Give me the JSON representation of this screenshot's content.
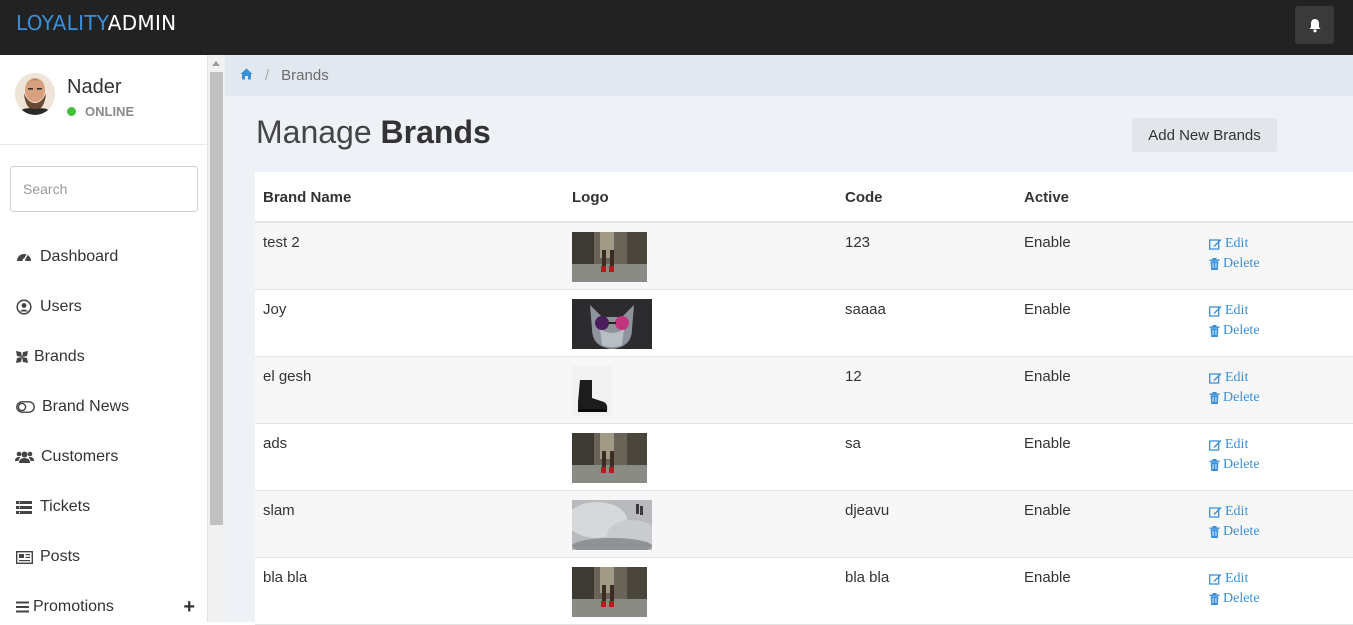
{
  "header": {
    "logo_part1": "LOYALITY",
    "logo_part2": "ADMIN",
    "accent_color": "#3a8fd9",
    "notification_icon": "bell-icon"
  },
  "sidebar": {
    "user": {
      "name": "Nader",
      "status": "ONLINE",
      "status_color": "#43c13b"
    },
    "search_placeholder": "Search",
    "items": [
      {
        "label": "Dashboard",
        "icon": "dashboard-icon"
      },
      {
        "label": "Users",
        "icon": "user-circle-icon"
      },
      {
        "label": "Brands",
        "icon": "brand-icon"
      },
      {
        "label": "Brand News",
        "icon": "toggle-icon"
      },
      {
        "label": "Customers",
        "icon": "users-icon"
      },
      {
        "label": "Tickets",
        "icon": "tickets-icon"
      },
      {
        "label": "Posts",
        "icon": "newspaper-icon"
      },
      {
        "label": "Promotions",
        "icon": "bars-icon",
        "expand": "+"
      }
    ]
  },
  "breadcrumb": {
    "home_icon": "home-icon",
    "separator": "/",
    "current": "Brands"
  },
  "main": {
    "title_light": "Manage",
    "title_bold": "Brands",
    "add_button": "Add New Brands",
    "columns": [
      "Brand Name",
      "Logo",
      "Code",
      "Active"
    ],
    "rows": [
      {
        "name": "test 2",
        "logo": "street-heels-photo",
        "code": "123",
        "active": "Enable"
      },
      {
        "name": "Joy",
        "logo": "cat-sunglasses-photo",
        "code": "saaaa",
        "active": "Enable"
      },
      {
        "name": "el gesh",
        "logo": "black-boot-photo",
        "code": "12",
        "active": "Enable"
      },
      {
        "name": "ads",
        "logo": "street-heels-photo",
        "code": "sa",
        "active": "Enable"
      },
      {
        "name": "slam",
        "logo": "smoke-shoes-photo",
        "code": "djeavu",
        "active": "Enable"
      },
      {
        "name": "bla bla",
        "logo": "street-heels-photo",
        "code": "bla bla",
        "active": "Enable"
      }
    ],
    "edit_label": "Edit",
    "delete_label": "Delete"
  }
}
